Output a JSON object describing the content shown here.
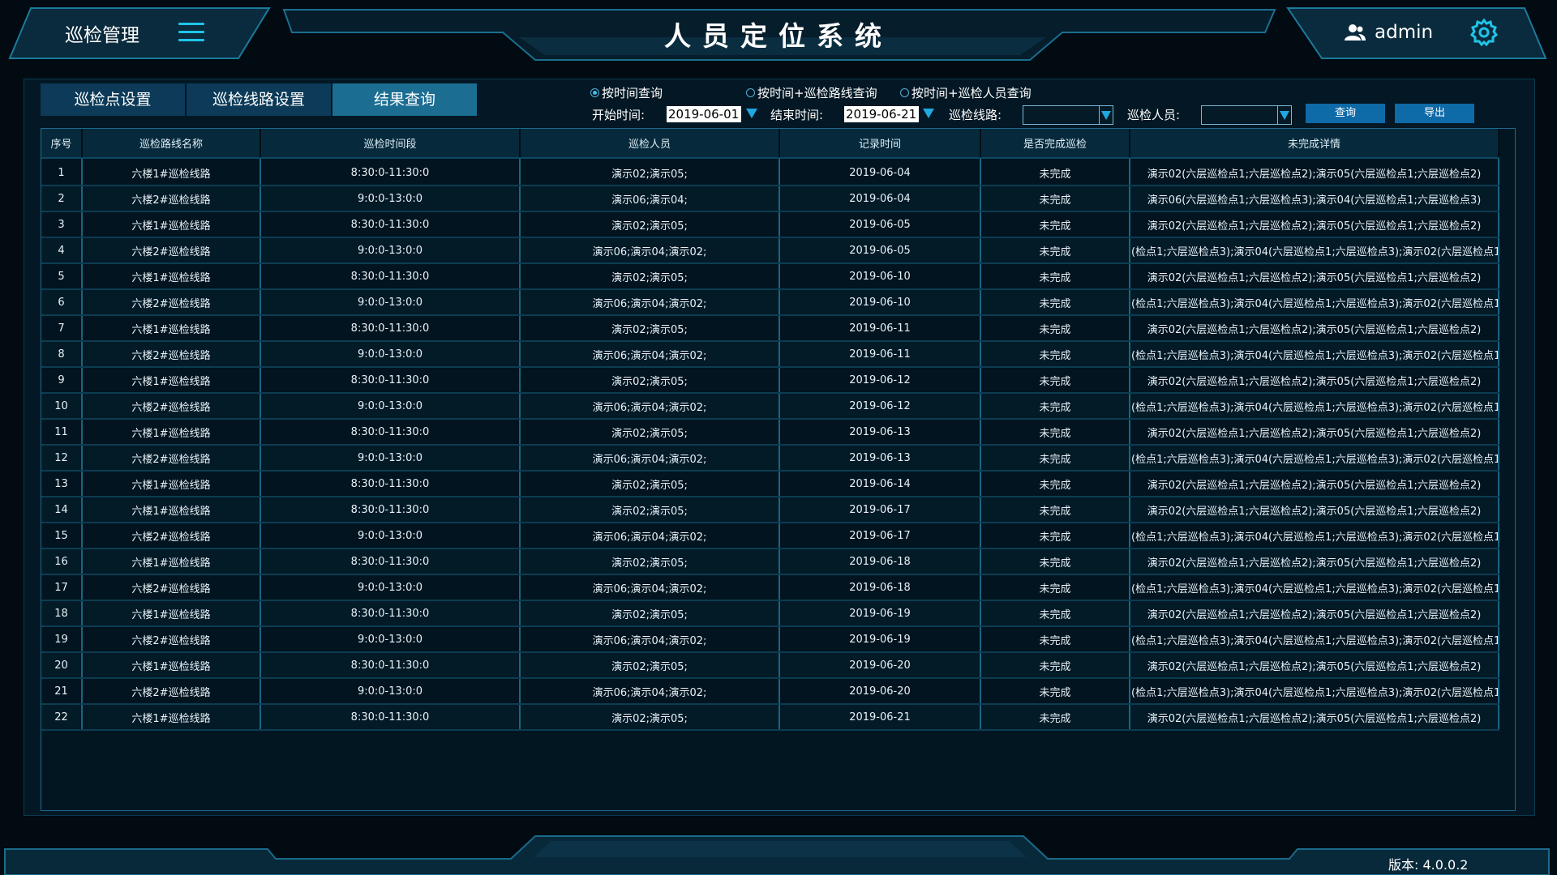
{
  "header": {
    "left_title": "巡检管理",
    "system_title": "人员定位系统",
    "user_name": "admin"
  },
  "tabs": [
    {
      "label": "巡检点设置",
      "active": false
    },
    {
      "label": "巡检线路设置",
      "active": false
    },
    {
      "label": "结果查询",
      "active": true
    }
  ],
  "filters": {
    "radio_options": [
      "按时间查询",
      "按时间+巡检路线查询",
      "按时间+巡检人员查询"
    ],
    "selected_radio": 0,
    "start_label": "开始时间:",
    "start_value": "2019-06-01",
    "end_label": "结束时间:",
    "end_value": "2019-06-21",
    "route_label": "巡检线路:",
    "route_value": "",
    "person_label": "巡检人员:",
    "person_value": "",
    "query_label": "查询",
    "export_label": "导出"
  },
  "table": {
    "columns": [
      "序号",
      "巡检路线名称",
      "巡检时间段",
      "巡检人员",
      "记录时间",
      "是否完成巡检",
      "未完成详情"
    ],
    "rows": [
      [
        "1",
        "六楼1#巡检线路",
        "8:30:0-11:30:0",
        "演示02;演示05;",
        "2019-06-04",
        "未完成",
        "演示02(六层巡检点1;六层巡检点2);演示05(六层巡检点1;六层巡检点2)"
      ],
      [
        "2",
        "六楼2#巡检线路",
        "9:0:0-13:0:0",
        "演示06;演示04;",
        "2019-06-04",
        "未完成",
        "演示06(六层巡检点1;六层巡检点3);演示04(六层巡检点1;六层巡检点3)"
      ],
      [
        "3",
        "六楼1#巡检线路",
        "8:30:0-11:30:0",
        "演示02;演示05;",
        "2019-06-05",
        "未完成",
        "演示02(六层巡检点1;六层巡检点2);演示05(六层巡检点1;六层巡检点2)"
      ],
      [
        "4",
        "六楼2#巡检线路",
        "9:0:0-13:0:0",
        "演示06;演示04;演示02;",
        "2019-06-05",
        "未完成",
        "(检点1;六层巡检点3);演示04(六层巡检点1;六层巡检点3);演示02(六层巡检点1;"
      ],
      [
        "5",
        "六楼1#巡检线路",
        "8:30:0-11:30:0",
        "演示02;演示05;",
        "2019-06-10",
        "未完成",
        "演示02(六层巡检点1;六层巡检点2);演示05(六层巡检点1;六层巡检点2)"
      ],
      [
        "6",
        "六楼2#巡检线路",
        "9:0:0-13:0:0",
        "演示06;演示04;演示02;",
        "2019-06-10",
        "未完成",
        "(检点1;六层巡检点3);演示04(六层巡检点1;六层巡检点3);演示02(六层巡检点1;"
      ],
      [
        "7",
        "六楼1#巡检线路",
        "8:30:0-11:30:0",
        "演示02;演示05;",
        "2019-06-11",
        "未完成",
        "演示02(六层巡检点1;六层巡检点2);演示05(六层巡检点1;六层巡检点2)"
      ],
      [
        "8",
        "六楼2#巡检线路",
        "9:0:0-13:0:0",
        "演示06;演示04;演示02;",
        "2019-06-11",
        "未完成",
        "(检点1;六层巡检点3);演示04(六层巡检点1;六层巡检点3);演示02(六层巡检点1;"
      ],
      [
        "9",
        "六楼1#巡检线路",
        "8:30:0-11:30:0",
        "演示02;演示05;",
        "2019-06-12",
        "未完成",
        "演示02(六层巡检点1;六层巡检点2);演示05(六层巡检点1;六层巡检点2)"
      ],
      [
        "10",
        "六楼2#巡检线路",
        "9:0:0-13:0:0",
        "演示06;演示04;演示02;",
        "2019-06-12",
        "未完成",
        "(检点1;六层巡检点3);演示04(六层巡检点1;六层巡检点3);演示02(六层巡检点1;"
      ],
      [
        "11",
        "六楼1#巡检线路",
        "8:30:0-11:30:0",
        "演示02;演示05;",
        "2019-06-13",
        "未完成",
        "演示02(六层巡检点1;六层巡检点2);演示05(六层巡检点1;六层巡检点2)"
      ],
      [
        "12",
        "六楼2#巡检线路",
        "9:0:0-13:0:0",
        "演示06;演示04;演示02;",
        "2019-06-13",
        "未完成",
        "(检点1;六层巡检点3);演示04(六层巡检点1;六层巡检点3);演示02(六层巡检点1;"
      ],
      [
        "13",
        "六楼1#巡检线路",
        "8:30:0-11:30:0",
        "演示02;演示05;",
        "2019-06-14",
        "未完成",
        "演示02(六层巡检点1;六层巡检点2);演示05(六层巡检点1;六层巡检点2)"
      ],
      [
        "14",
        "六楼1#巡检线路",
        "8:30:0-11:30:0",
        "演示02;演示05;",
        "2019-06-17",
        "未完成",
        "演示02(六层巡检点1;六层巡检点2);演示05(六层巡检点1;六层巡检点2)"
      ],
      [
        "15",
        "六楼2#巡检线路",
        "9:0:0-13:0:0",
        "演示06;演示04;演示02;",
        "2019-06-17",
        "未完成",
        "(检点1;六层巡检点3);演示04(六层巡检点1;六层巡检点3);演示02(六层巡检点1;"
      ],
      [
        "16",
        "六楼1#巡检线路",
        "8:30:0-11:30:0",
        "演示02;演示05;",
        "2019-06-18",
        "未完成",
        "演示02(六层巡检点1;六层巡检点2);演示05(六层巡检点1;六层巡检点2)"
      ],
      [
        "17",
        "六楼2#巡检线路",
        "9:0:0-13:0:0",
        "演示06;演示04;演示02;",
        "2019-06-18",
        "未完成",
        "(检点1;六层巡检点3);演示04(六层巡检点1;六层巡检点3);演示02(六层巡检点1;"
      ],
      [
        "18",
        "六楼1#巡检线路",
        "8:30:0-11:30:0",
        "演示02;演示05;",
        "2019-06-19",
        "未完成",
        "演示02(六层巡检点1;六层巡检点2);演示05(六层巡检点1;六层巡检点2)"
      ],
      [
        "19",
        "六楼2#巡检线路",
        "9:0:0-13:0:0",
        "演示06;演示04;演示02;",
        "2019-06-19",
        "未完成",
        "(检点1;六层巡检点3);演示04(六层巡检点1;六层巡检点3);演示02(六层巡检点1;"
      ],
      [
        "20",
        "六楼1#巡检线路",
        "8:30:0-11:30:0",
        "演示02;演示05;",
        "2019-06-20",
        "未完成",
        "演示02(六层巡检点1;六层巡检点2);演示05(六层巡检点1;六层巡检点2)"
      ],
      [
        "21",
        "六楼2#巡检线路",
        "9:0:0-13:0:0",
        "演示06;演示04;演示02;",
        "2019-06-20",
        "未完成",
        "(检点1;六层巡检点3);演示04(六层巡检点1;六层巡检点3);演示02(六层巡检点1;"
      ],
      [
        "22",
        "六楼1#巡检线路",
        "8:30:0-11:30:0",
        "演示02;演示05;",
        "2019-06-21",
        "未完成",
        "演示02(六层巡检点1;六层巡检点2);演示05(六层巡检点1;六层巡检点2)"
      ]
    ]
  },
  "footer": {
    "version": "版本: 4.0.0.2"
  },
  "icons": [
    "menu-icon",
    "user-icon",
    "gear-icon",
    "dropdown-arrow-icon"
  ],
  "colors": {
    "background": "#020b12",
    "accent": "#20c4e8",
    "tab": "#0c3a58",
    "tab_active": "#1b6d92",
    "button": "#0f6aa8"
  }
}
